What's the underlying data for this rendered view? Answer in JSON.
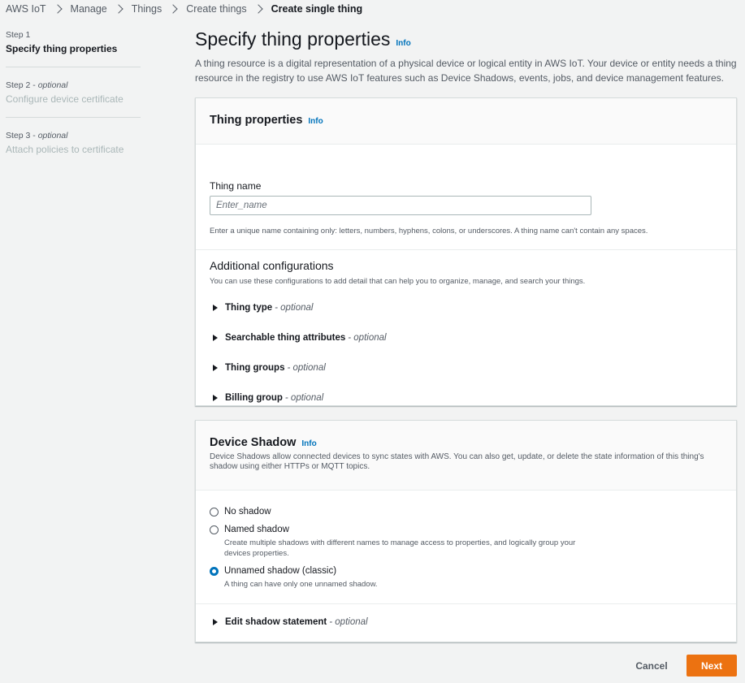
{
  "breadcrumb": {
    "items": [
      "AWS IoT",
      "Manage",
      "Things",
      "Create things"
    ],
    "current": "Create single thing"
  },
  "steps": [
    {
      "num": "Step 1",
      "optional": "",
      "title": "Specify thing properties"
    },
    {
      "num": "Step 2",
      "optional": "optional",
      "title": "Configure device certificate"
    },
    {
      "num": "Step 3",
      "optional": "optional",
      "title": "Attach policies to certificate"
    }
  ],
  "page": {
    "title": "Specify thing properties",
    "info": "Info",
    "description": "A thing resource is a digital representation of a physical device or logical entity in AWS IoT. Your device or entity needs a thing resource in the registry to use AWS IoT features such as Device Shadows, events, jobs, and device management features."
  },
  "thing_properties": {
    "title": "Thing properties",
    "info": "Info",
    "name_label": "Thing name",
    "name_placeholder": "Enter_name",
    "name_value": "",
    "name_hint": "Enter a unique name containing only: letters, numbers, hyphens, colons, or underscores. A thing name can't contain any spaces.",
    "additional_title": "Additional configurations",
    "additional_desc": "You can use these configurations to add detail that can help you to organize, manage, and search your things.",
    "expanders": [
      {
        "label": "Thing type",
        "optional": "- optional"
      },
      {
        "label": "Searchable thing attributes",
        "optional": "- optional"
      },
      {
        "label": "Thing groups",
        "optional": "- optional"
      },
      {
        "label": "Billing group",
        "optional": "- optional"
      }
    ]
  },
  "device_shadow": {
    "title": "Device Shadow",
    "info": "Info",
    "description": "Device Shadows allow connected devices to sync states with AWS. You can also get, update, or delete the state information of this thing's shadow using either HTTPs or MQTT topics.",
    "options": [
      {
        "label": "No shadow",
        "desc": "",
        "checked": false
      },
      {
        "label": "Named shadow",
        "desc": "Create multiple shadows with different names to manage access to properties, and logically group your devices properties.",
        "checked": false
      },
      {
        "label": "Unnamed shadow (classic)",
        "desc": "A thing can have only one unnamed shadow.",
        "checked": true
      }
    ],
    "edit_statement": {
      "label": "Edit shadow statement",
      "optional": "- optional"
    }
  },
  "footer": {
    "cancel": "Cancel",
    "next": "Next"
  },
  "colors": {
    "accent": "#0073bb",
    "primary_button": "#ec7211"
  }
}
